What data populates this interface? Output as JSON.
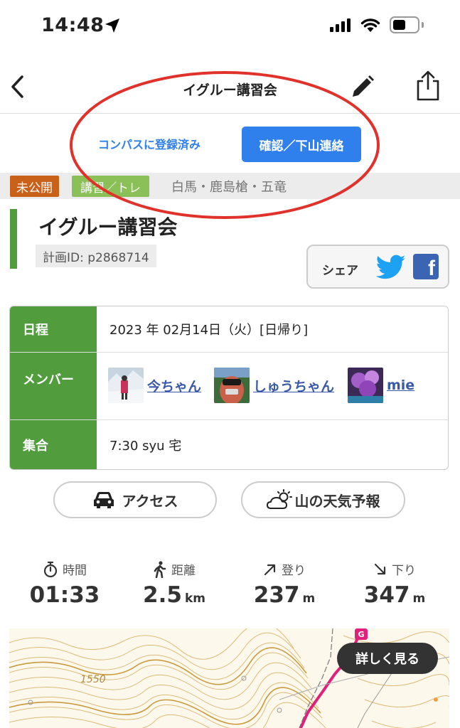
{
  "status_bar": {
    "time": "14:48"
  },
  "nav": {
    "title": "イグルー講習会"
  },
  "compass": {
    "registered_label": "コンパスに登録済み",
    "confirm_label": "確認／下山連絡"
  },
  "tags": {
    "visibility": "未公開",
    "type": "講習／トレ",
    "area": "白馬・鹿島槍・五竜"
  },
  "plan": {
    "title": "イグルー講習会",
    "id": "計画ID: p2868714"
  },
  "share": {
    "label": "シェア"
  },
  "info": {
    "schedule_label": "日程",
    "schedule_value": "2023 年 02月14日（火）[日帰り]",
    "members_label": "メンバー",
    "members": [
      {
        "name": "今ちゃん"
      },
      {
        "name": "しゅうちゃん"
      },
      {
        "name": "mie"
      }
    ],
    "meeting_label": "集合",
    "meeting_value": "7:30 syu 宅"
  },
  "buttons": {
    "access": "アクセス",
    "weather": "山の天気予報"
  },
  "stats": {
    "time": {
      "label": "時間",
      "value": "01:33",
      "unit": ""
    },
    "distance": {
      "label": "距離",
      "value": "2.5",
      "unit": "km"
    },
    "ascent": {
      "label": "登り",
      "value": "237",
      "unit": "m"
    },
    "descent": {
      "label": "下り",
      "value": "347",
      "unit": "m"
    }
  },
  "map": {
    "contour_label": "1550",
    "goal_marker": "G",
    "detail_button": "詳しく見る"
  },
  "colors": {
    "accent_blue": "#2f80ed",
    "green": "#519c3d",
    "tag_orange": "#c9611b",
    "tag_green": "#8ac057",
    "annotation_red": "#e0312a"
  }
}
